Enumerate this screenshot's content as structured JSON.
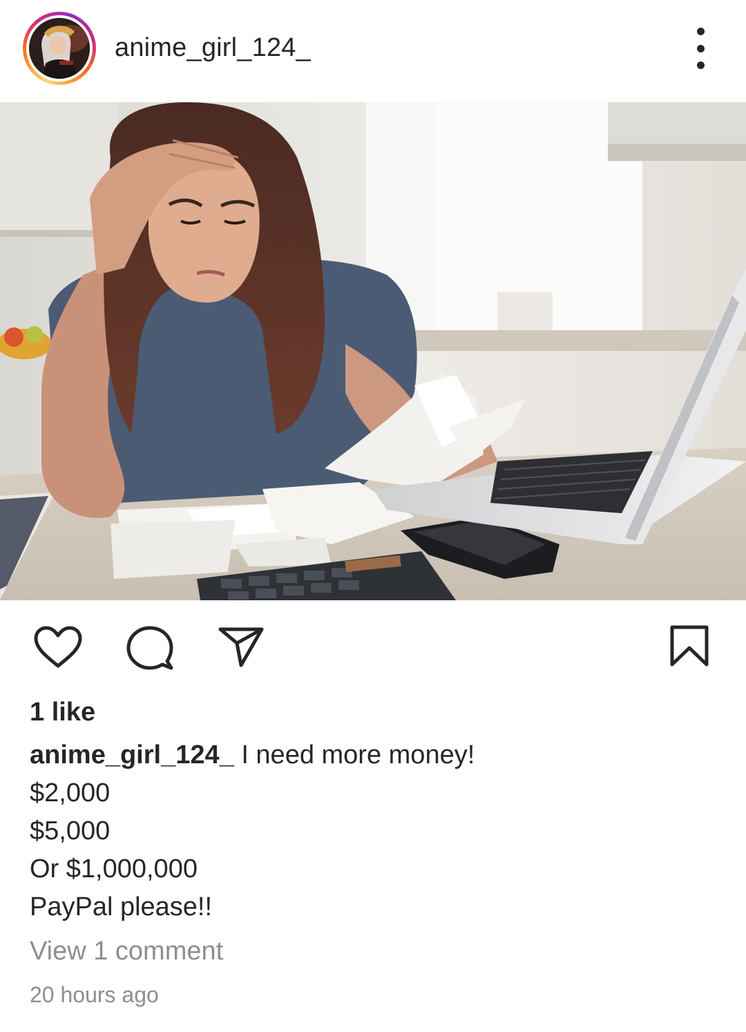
{
  "post": {
    "username": "anime_girl_124_",
    "likes_text": "1 like",
    "caption": {
      "username": "anime_girl_124_",
      "lines": [
        "I need more money!",
        "$2,000",
        "$5,000",
        "Or $1,000,000",
        "PayPal please!!"
      ]
    },
    "view_comments": "View 1 comment",
    "timestamp": "20 hours ago"
  },
  "icons": {
    "more": "more-vertical-icon",
    "like": "heart-icon",
    "comment": "comment-bubble-icon",
    "share": "paper-plane-icon",
    "save": "bookmark-icon"
  },
  "colors": {
    "text": "#262626",
    "secondary_text": "#8e8e8e",
    "story_ring": [
      "#feda75",
      "#fa7e1e",
      "#d62976",
      "#962fbf"
    ]
  }
}
